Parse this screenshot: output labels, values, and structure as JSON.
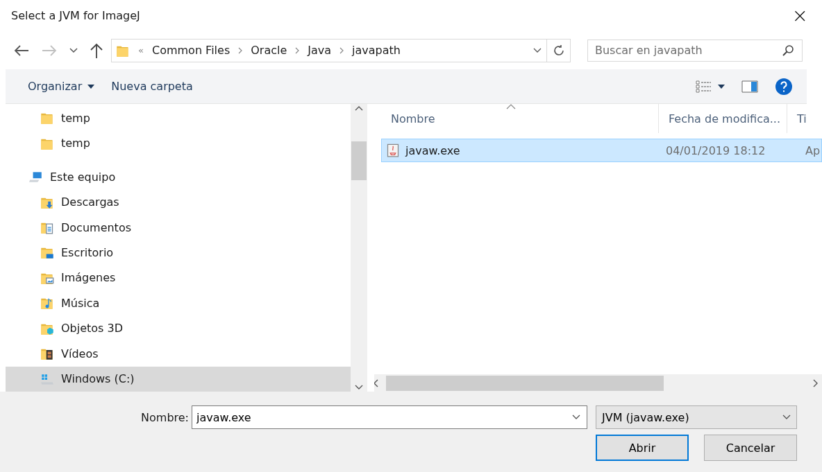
{
  "window": {
    "title": "Select a JVM for ImageJ",
    "close": "×"
  },
  "address": {
    "overflow": "«",
    "crumbs": [
      "Common Files",
      "Oracle",
      "Java",
      "javapath"
    ]
  },
  "search": {
    "placeholder": "Buscar en javapath"
  },
  "toolbar": {
    "organize": "Organizar",
    "new_folder": "Nueva carpeta"
  },
  "sidebar": {
    "items": [
      {
        "label": "temp",
        "kind": "folder",
        "selected": false
      },
      {
        "label": "temp",
        "kind": "folder",
        "selected": false
      },
      {
        "label": "Este equipo",
        "kind": "computer",
        "selected": false
      },
      {
        "label": "Descargas",
        "kind": "downloads",
        "selected": false
      },
      {
        "label": "Documentos",
        "kind": "documents",
        "selected": false
      },
      {
        "label": "Escritorio",
        "kind": "desktop",
        "selected": false
      },
      {
        "label": "Imágenes",
        "kind": "pictures",
        "selected": false
      },
      {
        "label": "Música",
        "kind": "music",
        "selected": false
      },
      {
        "label": "Objetos 3D",
        "kind": "objects",
        "selected": false
      },
      {
        "label": "Vídeos",
        "kind": "videos",
        "selected": false
      },
      {
        "label": "Windows (C:)",
        "kind": "drive",
        "selected": true
      }
    ]
  },
  "table": {
    "columns": [
      "Nombre",
      "Fecha de modifica...",
      "Ti"
    ],
    "rows": [
      {
        "name": "javaw.exe",
        "date": "04/01/2019 18:12",
        "column_3": "Ap",
        "selected": true
      }
    ]
  },
  "footer": {
    "name_label": "Nombre:",
    "name_value": "javaw.exe",
    "filter": "JVM (javaw.exe)",
    "buttons": [
      "Abrir",
      "Cancelar"
    ]
  }
}
